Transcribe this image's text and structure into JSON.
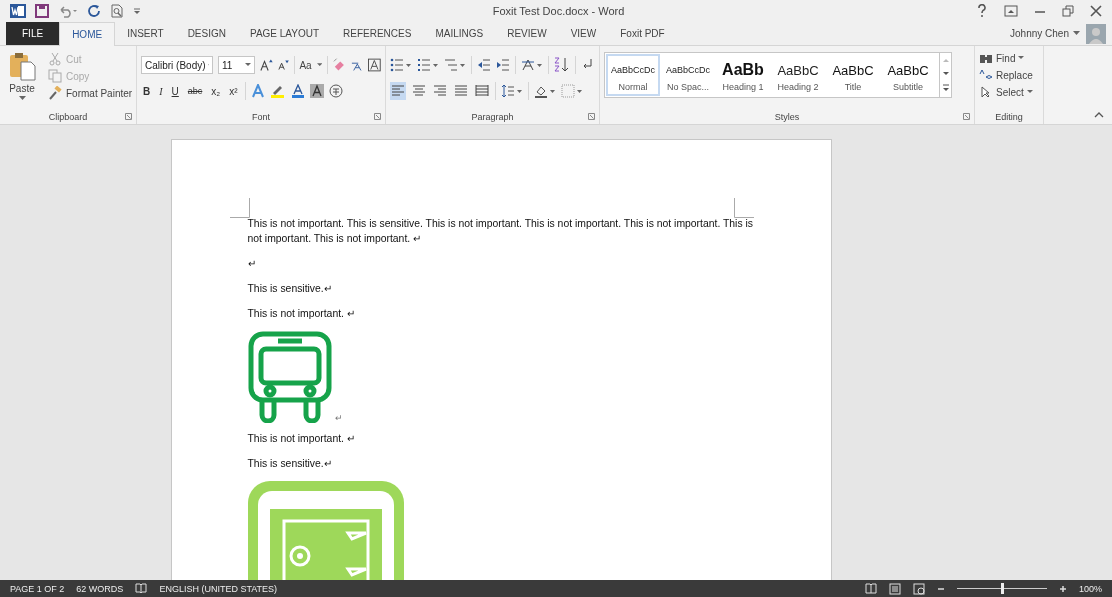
{
  "window": {
    "title": "Foxit Test Doc.docx - Word"
  },
  "tabs": [
    {
      "label": "FILE",
      "kind": "file",
      "selected": false
    },
    {
      "label": "HOME",
      "kind": "tab",
      "selected": true
    },
    {
      "label": "INSERT",
      "kind": "tab",
      "selected": false
    },
    {
      "label": "DESIGN",
      "kind": "tab",
      "selected": false
    },
    {
      "label": "PAGE LAYOUT",
      "kind": "tab",
      "selected": false
    },
    {
      "label": "REFERENCES",
      "kind": "tab",
      "selected": false
    },
    {
      "label": "MAILINGS",
      "kind": "tab",
      "selected": false
    },
    {
      "label": "REVIEW",
      "kind": "tab",
      "selected": false
    },
    {
      "label": "VIEW",
      "kind": "tab",
      "selected": false
    },
    {
      "label": "Foxit PDF",
      "kind": "tab",
      "selected": false
    }
  ],
  "user": {
    "name": "Johnny Chen"
  },
  "ribbon": {
    "clipboard": {
      "label": "Clipboard",
      "paste": "Paste",
      "items": [
        {
          "label": "Cut",
          "kind": "cut",
          "disabled": true
        },
        {
          "label": "Copy",
          "kind": "copy",
          "disabled": true
        },
        {
          "label": "Format Painter",
          "kind": "painter",
          "disabled": false
        }
      ]
    },
    "font": {
      "label": "Font",
      "font_name": "Calibri (Body)",
      "font_size": "11",
      "change_case": "Aa",
      "buttons": [
        {
          "label": "B",
          "kind": "bold"
        },
        {
          "label": "I",
          "kind": "italic"
        },
        {
          "label": "U",
          "kind": "underline"
        },
        {
          "label": "abc",
          "kind": "strike"
        },
        {
          "label": "x₂",
          "kind": "plain"
        },
        {
          "label": "x²",
          "kind": "plain"
        }
      ]
    },
    "paragraph": {
      "label": "Paragraph",
      "alignments": [
        {
          "kind": "left",
          "selected": true
        },
        {
          "kind": "center",
          "selected": false
        },
        {
          "kind": "right",
          "selected": false
        },
        {
          "kind": "justify",
          "selected": false
        },
        {
          "kind": "distributed",
          "selected": false
        }
      ]
    },
    "styles": {
      "label": "Styles",
      "items": [
        {
          "preview": "AaBbCcDc",
          "name": "Normal",
          "kind": "normal",
          "selected": true
        },
        {
          "preview": "AaBbCcDc",
          "name": "No Spac...",
          "kind": "normal",
          "selected": false
        },
        {
          "preview": "AaBb",
          "name": "Heading 1",
          "kind": "h1",
          "selected": false
        },
        {
          "preview": "AaBbC",
          "name": "Heading 2",
          "kind": "h2",
          "selected": false
        },
        {
          "preview": "AaBbC",
          "name": "Title",
          "kind": "title",
          "selected": false
        },
        {
          "preview": "AaBbC",
          "name": "Subtitle",
          "kind": "title",
          "selected": false
        }
      ]
    },
    "editing": {
      "label": "Editing",
      "items": [
        {
          "label": "Find",
          "kind": "find"
        },
        {
          "label": "Replace",
          "kind": "replace"
        },
        {
          "label": "Select",
          "kind": "select"
        }
      ]
    }
  },
  "document": {
    "paragraphs": [
      {
        "kind": "text",
        "text": "This is not important. This is sensitive. This is not important. This is not important. This is not important. This is not important. This is not important. ↵"
      },
      {
        "kind": "text",
        "text": "↵"
      },
      {
        "kind": "text",
        "text": "This is sensitive.↵"
      },
      {
        "kind": "text",
        "text": "This is not important. ↵"
      },
      {
        "kind": "bus",
        "text": "↵"
      },
      {
        "kind": "text",
        "text": "This is not important. ↵"
      },
      {
        "kind": "text",
        "text": "This is sensitive.↵"
      },
      {
        "kind": "safe"
      }
    ]
  },
  "status_bar": {
    "page": "PAGE 1 OF 2",
    "words": "62 WORDS",
    "language": "ENGLISH (UNITED STATES)",
    "zoom": "100%",
    "zoom_level": {
      "level": 0.5
    }
  }
}
